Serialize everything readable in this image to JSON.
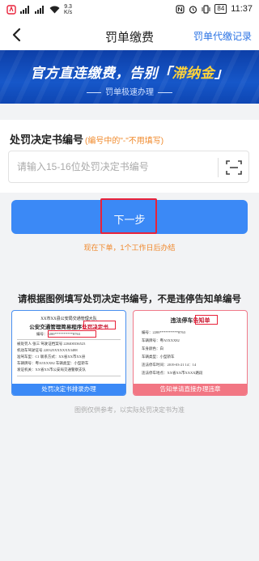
{
  "status_bar": {
    "speed_value": "9.3",
    "speed_unit": "K/s",
    "battery": "84",
    "time": "11:37"
  },
  "nav": {
    "title": "罚单缴费",
    "right_link": "罚单代缴记录"
  },
  "banner": {
    "title_part1": "官方直连缴费，告别「",
    "title_highlight": "滞纳金",
    "title_part2": "」",
    "subtitle": "罚单极速办理"
  },
  "form": {
    "label": "处罚决定书编号",
    "hint": "(编号中的\"-\"不用填写)",
    "input_value": "",
    "input_placeholder": "请输入15-16位处罚决定书编号"
  },
  "action": {
    "next_label": "下一步",
    "note": "现在下单，1个工作日后办结"
  },
  "guide": {
    "title": "请根据图例填写处罚决定书编号，不是违停告知单编号",
    "left_sample": {
      "header_1": "XX市XX县公安局交通管理大队",
      "header_2": "公安交通管理简易程序",
      "header_hl": "处罚决定书",
      "number_label": "编号：",
      "number_value": "2200**********8763",
      "rows": [
        "被处罚人  张三        驾驶证档案号  220400336523",
        "机动车驾驶证号  220325XXXXXX3488",
        "准驾车型：C1      联系方式：XX省XX市XX县",
        "车辆牌号：粤A5XXX82   车辆类型：小型轿车",
        "发证机关：XX省XX市公安局交通警察支队"
      ],
      "caption": "处罚决定书排录办理"
    },
    "right_sample": {
      "header": "违法停车",
      "header_hl": "告知单",
      "rows": [
        "编号：2200**********8763",
        "车辆牌号：粤A5XXX82",
        "车身颜色：白",
        "车辆类型：小型轿车",
        "违法停车时间：2019-03-21  14：14",
        "违法停车地点：XX省XX市XXXX路段"
      ],
      "caption": "告知单请直接办理违章"
    },
    "footnote": "图例仅供参考，以实际处罚决定书为准"
  },
  "colors": {
    "accent": "#3b89f6",
    "link": "#2b73e4",
    "warn": "#f0882c",
    "highlight_red": "#e8223a",
    "banner_blue": "#1657c9",
    "banner_yellow": "#ffd33a"
  }
}
